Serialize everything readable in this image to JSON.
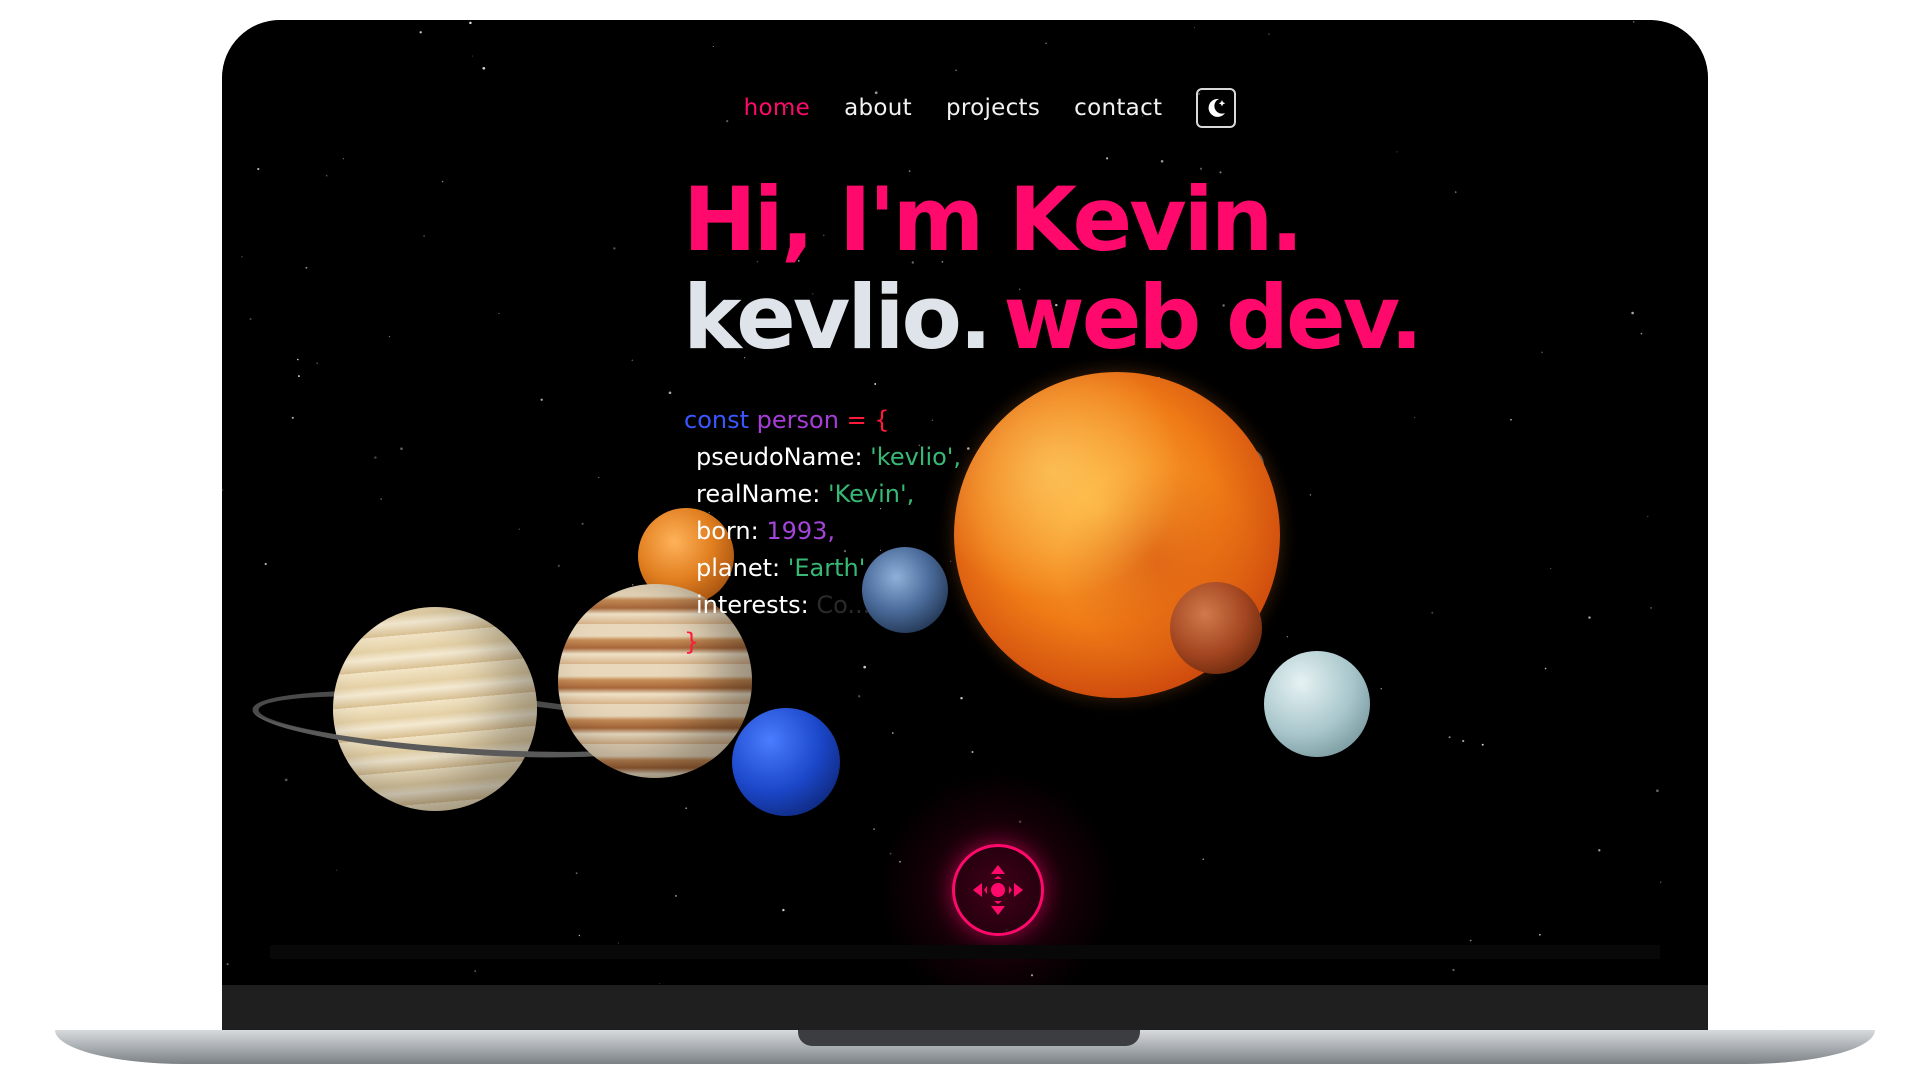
{
  "nav": {
    "items": [
      "home",
      "about",
      "projects",
      "contact"
    ],
    "active": "home",
    "theme_toggle_icon": "moon-star-icon"
  },
  "hero": {
    "greeting": "Hi, I'm Kevin.",
    "handle": "kevlio.",
    "role": "web dev."
  },
  "code": {
    "keyword": "const",
    "var_name": "person",
    "assign": "= {",
    "close": "}",
    "fields": [
      {
        "key": "pseudoName:",
        "value": "'kevlio',"
      },
      {
        "key": "realName:",
        "value": "'Kevin',"
      },
      {
        "key": "born:",
        "value": "1993,"
      },
      {
        "key": "planet:",
        "value": "'Earth'"
      },
      {
        "key": "interests:",
        "value": "Co..."
      }
    ]
  },
  "controls": {
    "move_icon": "move-arrows-icon"
  },
  "colors": {
    "accent": "#ff0a6c",
    "background": "#000000",
    "handle_text": "#dfe3ea",
    "keyword": "#3a56ff",
    "variable": "#a63dd6",
    "string": "#38b875",
    "number": "#a245d8"
  }
}
